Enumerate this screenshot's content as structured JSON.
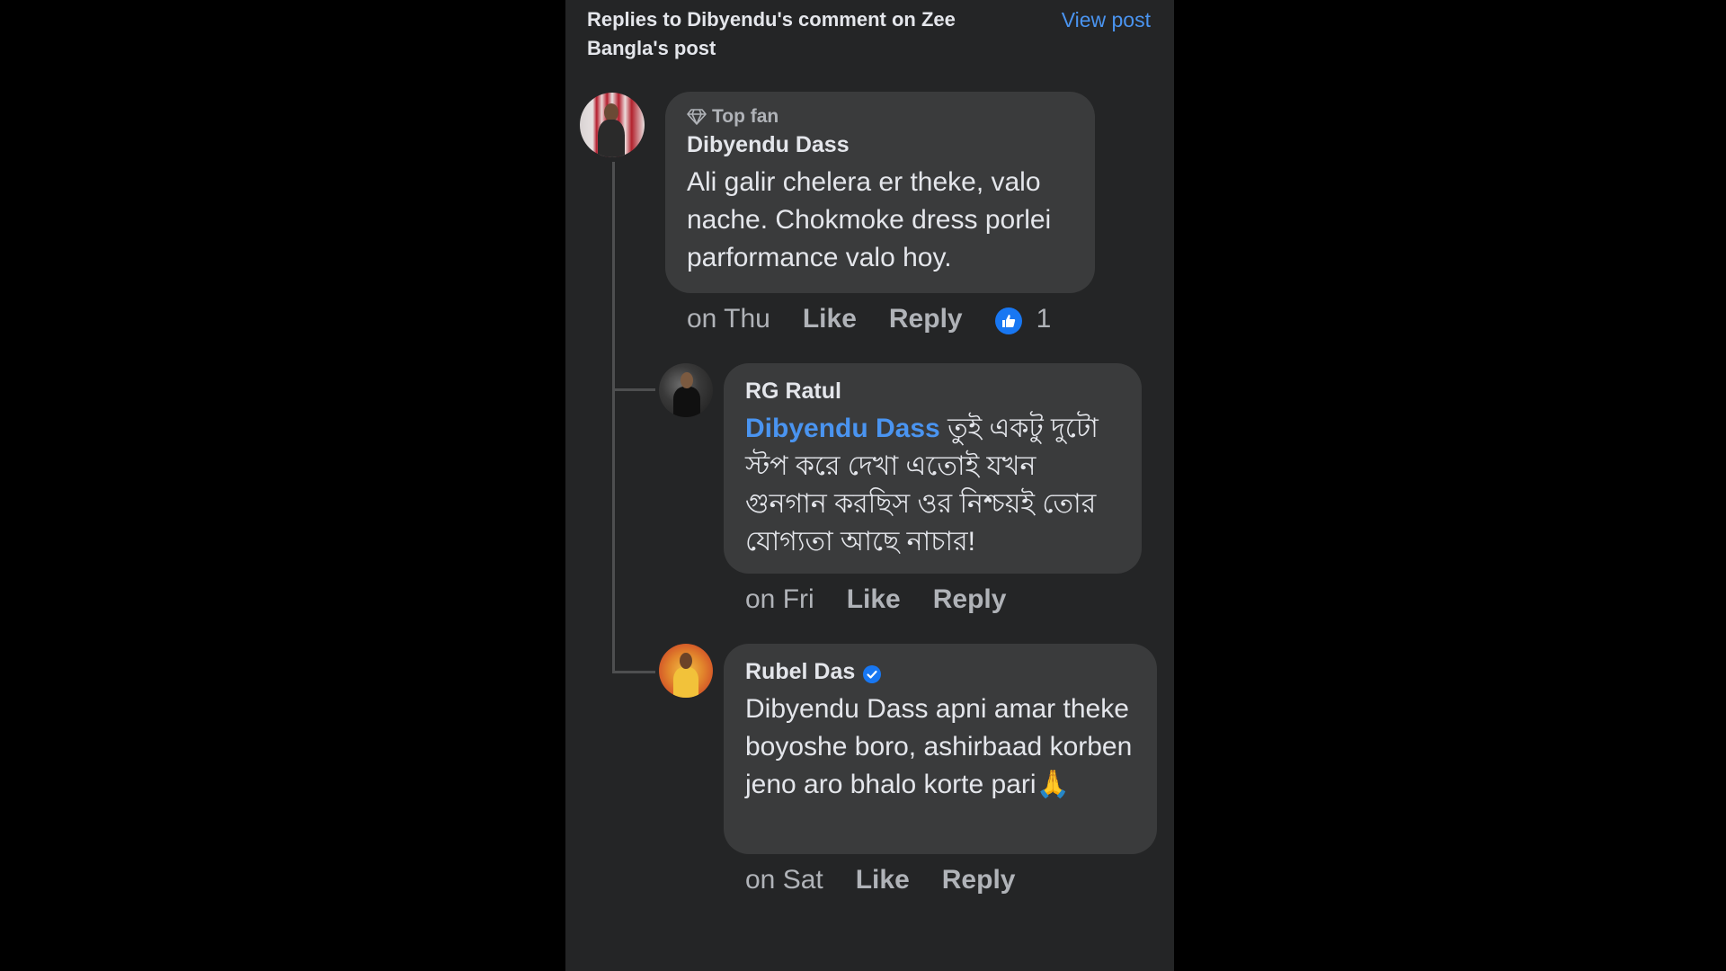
{
  "header": {
    "title": "Replies to Dibyendu's comment on Zee Bangla's post",
    "view_post": "View post"
  },
  "comments": [
    {
      "badge": "Top fan",
      "author": "Dibyendu Dass",
      "text": "Ali galir chelera er theke, valo nache. Chokmoke dress porlei parformance valo hoy.",
      "time": "on Thu",
      "like": "Like",
      "reply": "Reply",
      "reaction_count": "1"
    },
    {
      "author": "RG Ratul",
      "mention": "Dibyendu Dass",
      "text": " তুই একটু দুটো স্টপ করে দেখা এতোই যখন গুনগান করছিস ওর নিশ্চয়ই তোর যোগ্যতা আছে নাচার!",
      "time": "on Fri",
      "like": "Like",
      "reply": "Reply"
    },
    {
      "author": "Rubel Das",
      "verified": true,
      "text": "Dibyendu Dass apni amar theke boyoshe boro, ashirbaad korben jeno aro bhalo korte pari",
      "emoji": "🙏",
      "time": "on Sat",
      "like": "Like",
      "reply": "Reply"
    }
  ],
  "colors": {
    "background": "#242526",
    "bubble": "#3a3b3c",
    "link": "#4a94f0",
    "like_blue": "#1877f2"
  }
}
